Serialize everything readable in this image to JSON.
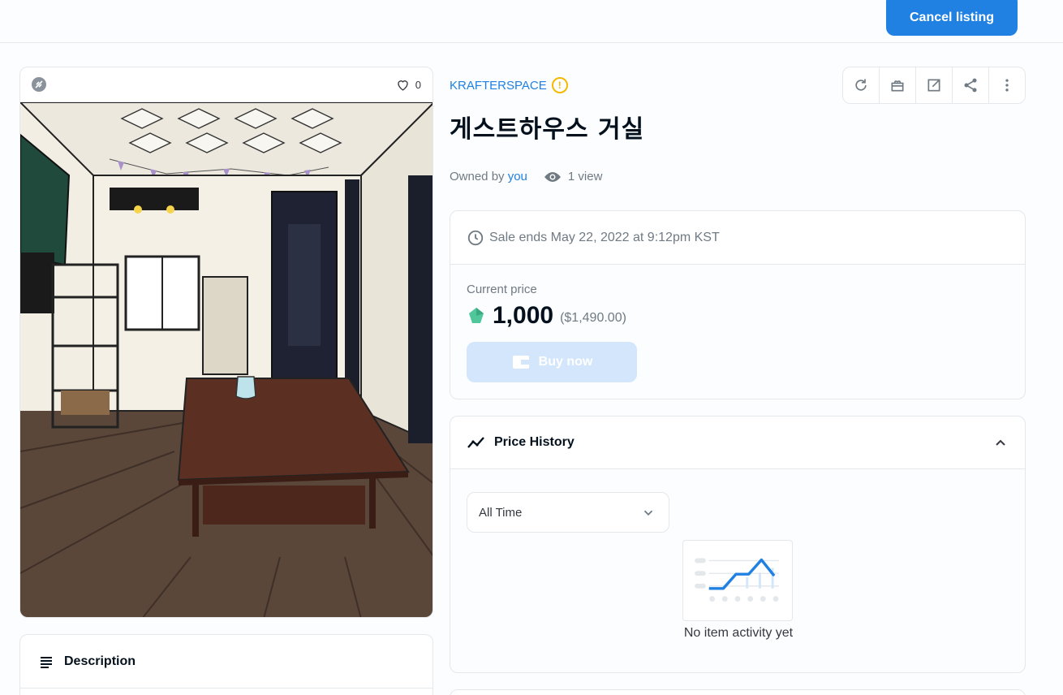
{
  "header": {
    "cancel_label": "Cancel listing"
  },
  "media": {
    "favorite_count": "0"
  },
  "collection": {
    "name": "KRAFTERSPACE",
    "warning_glyph": "!"
  },
  "item": {
    "title": "게스트하우스 거실"
  },
  "meta": {
    "owned_by": "Owned by",
    "owner": "you",
    "views": "1 view"
  },
  "sale": {
    "ends_text": "Sale ends May 22, 2022 at 9:12pm KST",
    "price_label": "Current price",
    "price": "1,000",
    "price_usd": "($1,490.00)",
    "buy_label": "Buy now"
  },
  "price_history": {
    "title": "Price History",
    "range": "All Time",
    "empty_text": "No item activity yet"
  },
  "description": {
    "title": "Description"
  },
  "colors": {
    "accent": "#2081e2",
    "warning": "#f5b900",
    "buy_disabled": "#d3e6fb"
  },
  "icons": [
    "chain-icon",
    "heart-icon",
    "refresh-icon",
    "gift-icon",
    "external-link-icon",
    "share-icon",
    "more-vertical-icon",
    "clock-icon",
    "eye-icon",
    "token-icon",
    "wallet-icon",
    "trend-icon",
    "chevron-up-icon",
    "chevron-down-icon",
    "list-icon"
  ]
}
